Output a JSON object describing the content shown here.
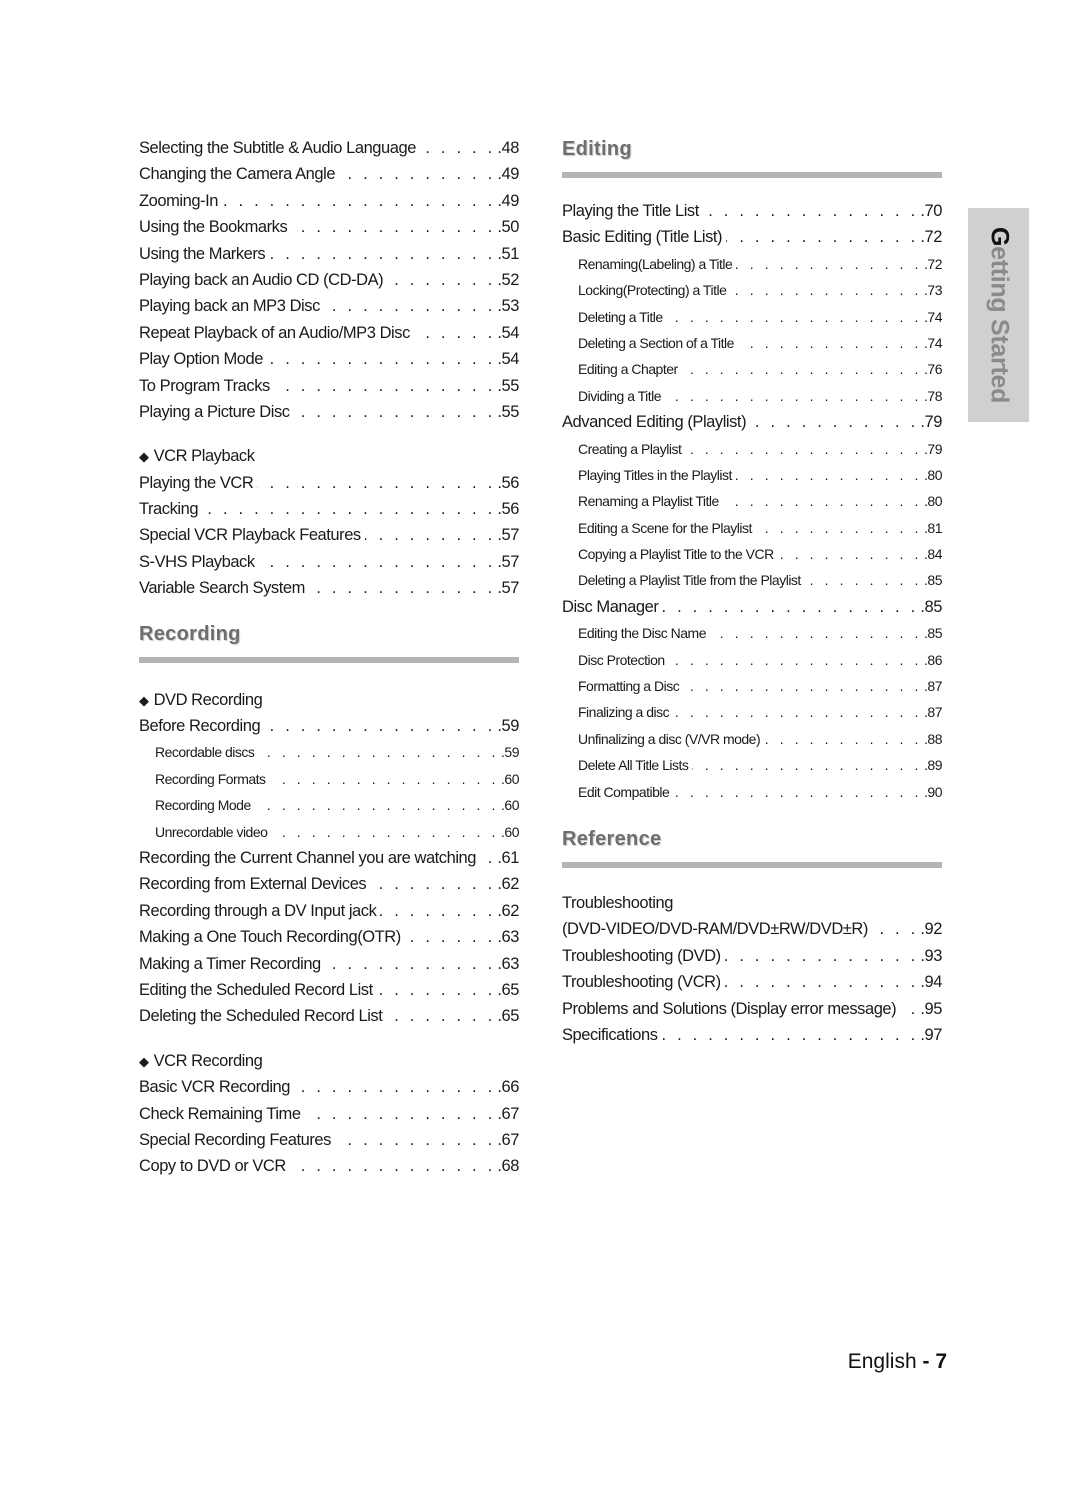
{
  "side_tab": {
    "first_letter": "G",
    "rest": "etting Started"
  },
  "footer": {
    "language": "English",
    "separator": " - ",
    "page_number": "7"
  },
  "left_column": {
    "playback_items": [
      {
        "title": "Selecting the Subtitle & Audio Language",
        "page": ".48"
      },
      {
        "title": "Changing the Camera Angle",
        "page": ".49"
      },
      {
        "title": "Zooming-In",
        "page": ".49"
      },
      {
        "title": "Using the Bookmarks",
        "page": ".50"
      },
      {
        "title": "Using the Markers",
        "page": ".51"
      },
      {
        "title": "Playing back an Audio CD (CD-DA)",
        "page": ".52"
      },
      {
        "title": "Playing back an MP3 Disc",
        "page": ".53"
      },
      {
        "title": "Repeat Playback of an Audio/MP3 Disc",
        "page": ".54"
      },
      {
        "title": "Play Option Mode",
        "page": ".54"
      },
      {
        "title": "To Program Tracks",
        "page": ".55"
      },
      {
        "title": "Playing a Picture Disc",
        "page": ".55"
      }
    ],
    "vcr_playback": {
      "heading": "VCR Playback",
      "items": [
        {
          "title": "Playing the VCR",
          "page": ".56"
        },
        {
          "title": "Tracking",
          "page": ".56"
        },
        {
          "title": "Special VCR Playback Features",
          "page": ".57"
        },
        {
          "title": "S-VHS Playback",
          "page": ".57"
        },
        {
          "title": "Variable Search System",
          "page": ".57"
        }
      ]
    },
    "recording": {
      "heading": "Recording",
      "dvd_recording": {
        "heading": "DVD Recording",
        "items": [
          {
            "title": "Before Recording",
            "page": ".59",
            "level": 1
          },
          {
            "title": "Recordable discs",
            "page": ".59",
            "level": 2
          },
          {
            "title": "Recording Formats",
            "page": ".60",
            "level": 2
          },
          {
            "title": "Recording Mode",
            "page": ".60",
            "level": 2
          },
          {
            "title": "Unrecordable video",
            "page": ".60",
            "level": 2
          },
          {
            "title": "Recording the Current Channel you are watching",
            "page": ".61",
            "level": 1
          },
          {
            "title": "Recording from External Devices",
            "page": ".62",
            "level": 1
          },
          {
            "title": "Recording through a DV Input jack",
            "page": ".62",
            "level": 1
          },
          {
            "title": "Making a One Touch Recording(OTR)",
            "page": ".63",
            "level": 1
          },
          {
            "title": "Making a Timer Recording",
            "page": ".63",
            "level": 1
          },
          {
            "title": "Editing the Scheduled Record List",
            "page": ".65",
            "level": 1
          },
          {
            "title": "Deleting the Scheduled Record List",
            "page": ".65",
            "level": 1
          }
        ]
      },
      "vcr_recording": {
        "heading": "VCR Recording",
        "items": [
          {
            "title": "Basic VCR Recording",
            "page": ".66"
          },
          {
            "title": "Check Remaining Time",
            "page": ".67"
          },
          {
            "title": "Special Recording Features",
            "page": ".67"
          },
          {
            "title": "Copy to DVD or VCR",
            "page": ".68"
          }
        ]
      }
    }
  },
  "right_column": {
    "editing": {
      "heading": "Editing",
      "items": [
        {
          "title": "Playing the Title List",
          "page": ".70",
          "level": 1
        },
        {
          "title": "Basic Editing (Title List)",
          "page": ".72",
          "level": 1
        },
        {
          "title": "Renaming(Labeling) a Title",
          "page": ".72",
          "level": 2
        },
        {
          "title": "Locking(Protecting) a Title",
          "page": ".73",
          "level": 2
        },
        {
          "title": "Deleting a Title",
          "page": ".74",
          "level": 2
        },
        {
          "title": "Deleting a Section of a Title",
          "page": ".74",
          "level": 2
        },
        {
          "title": "Editing a Chapter",
          "page": ".76",
          "level": 2
        },
        {
          "title": "Dividing a Title",
          "page": ".78",
          "level": 2
        },
        {
          "title": "Advanced Editing (Playlist)",
          "page": ".79",
          "level": 1
        },
        {
          "title": "Creating a Playlist",
          "page": ".79",
          "level": 2
        },
        {
          "title": "Playing Titles in the Playlist",
          "page": ".80",
          "level": 2
        },
        {
          "title": "Renaming a Playlist Title",
          "page": ".80",
          "level": 2
        },
        {
          "title": "Editing a Scene for the Playlist",
          "page": ".81",
          "level": 2
        },
        {
          "title": "Copying a Playlist Title to the VCR",
          "page": ".84",
          "level": 2
        },
        {
          "title": "Deleting a Playlist Title from the Playlist",
          "page": ".85",
          "level": 2
        },
        {
          "title": "Disc Manager",
          "page": ".85",
          "level": 1
        },
        {
          "title": "Editing the Disc Name",
          "page": ".85",
          "level": 2
        },
        {
          "title": "Disc Protection",
          "page": ".86",
          "level": 2
        },
        {
          "title": "Formatting a Disc",
          "page": ".87",
          "level": 2
        },
        {
          "title": "Finalizing a disc",
          "page": ".87",
          "level": 2
        },
        {
          "title": "Unfinalizing a disc (V/VR mode)",
          "page": ".88",
          "level": 2
        },
        {
          "title": "Delete All Title Lists",
          "page": ".89",
          "level": 2
        },
        {
          "title": "Edit Compatible",
          "page": ".90",
          "level": 2
        }
      ]
    },
    "reference": {
      "heading": "Reference",
      "items": [
        {
          "title": "Troubleshooting",
          "page": ""
        },
        {
          "title": "(DVD-VIDEO/DVD-RAM/DVD±RW/DVD±R)",
          "page": ".92"
        },
        {
          "title": "Troubleshooting (DVD)",
          "page": ".93"
        },
        {
          "title": "Troubleshooting (VCR)",
          "page": ".94"
        },
        {
          "title": "Problems and Solutions (Display error message)",
          "page": ".95"
        },
        {
          "title": "Specifications",
          "page": ".97"
        }
      ]
    }
  }
}
